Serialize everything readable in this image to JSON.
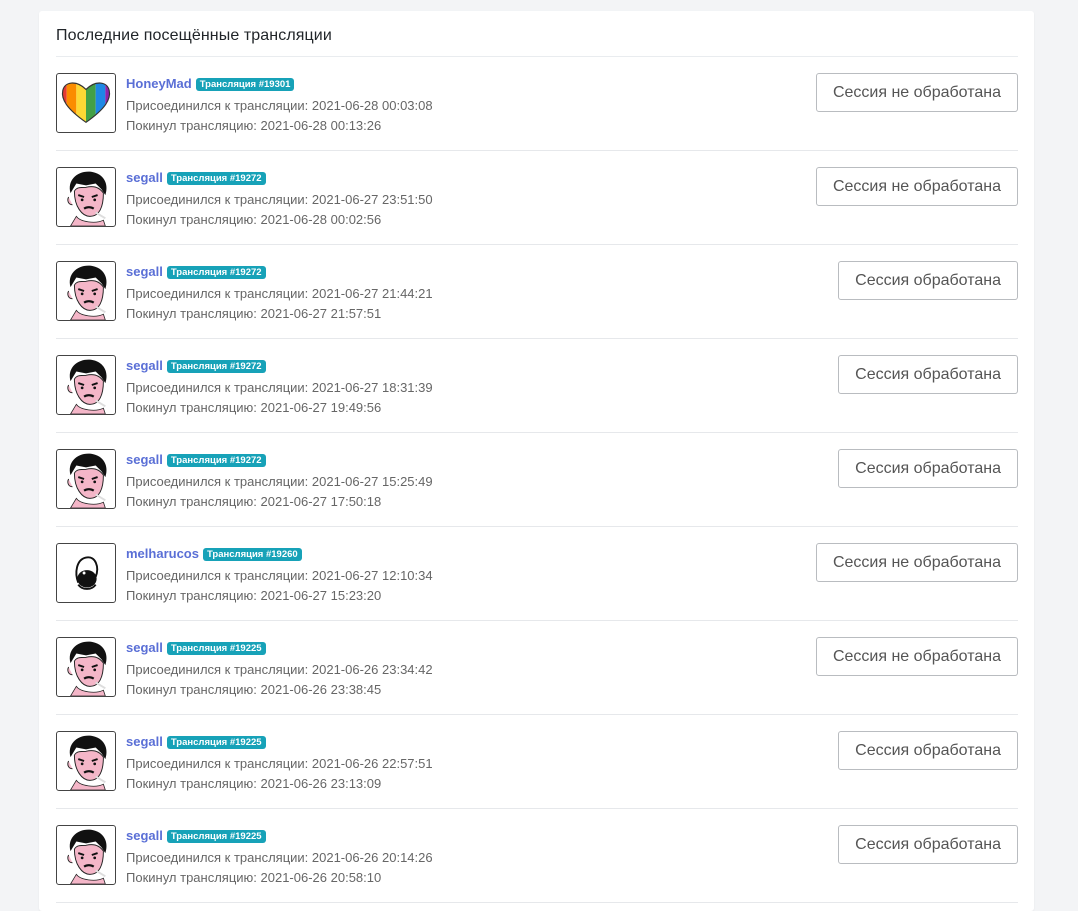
{
  "page": {
    "title": "Последние посещённые трансляции"
  },
  "sessions": [
    {
      "user": "HoneyMad",
      "avatar": "rainbow-heart",
      "badge": "Трансляция #19301",
      "joined": "Присоединился к трансляции: 2021-06-28 00:03:08",
      "left": "Покинул трансляцию: 2021-06-28 00:13:26",
      "status": "Сессия не обработана"
    },
    {
      "user": "segall",
      "avatar": "man-portrait",
      "badge": "Трансляция #19272",
      "joined": "Присоединился к трансляции: 2021-06-27 23:51:50",
      "left": "Покинул трансляцию: 2021-06-28 00:02:56",
      "status": "Сессия не обработана"
    },
    {
      "user": "segall",
      "avatar": "man-portrait",
      "badge": "Трансляция #19272",
      "joined": "Присоединился к трансляции: 2021-06-27 21:44:21",
      "left": "Покинул трансляцию: 2021-06-27 21:57:51",
      "status": "Сессия обработана"
    },
    {
      "user": "segall",
      "avatar": "man-portrait",
      "badge": "Трансляция #19272",
      "joined": "Присоединился к трансляции: 2021-06-27 18:31:39",
      "left": "Покинул трансляцию: 2021-06-27 19:49:56",
      "status": "Сессия обработана"
    },
    {
      "user": "segall",
      "avatar": "man-portrait",
      "badge": "Трансляция #19272",
      "joined": "Присоединился к трансляции: 2021-06-27 15:25:49",
      "left": "Покинул трансляцию: 2021-06-27 17:50:18",
      "status": "Сессия обработана"
    },
    {
      "user": "melharucos",
      "avatar": "line-drawing",
      "badge": "Трансляция #19260",
      "joined": "Присоединился к трансляции: 2021-06-27 12:10:34",
      "left": "Покинул трансляцию: 2021-06-27 15:23:20",
      "status": "Сессия не обработана"
    },
    {
      "user": "segall",
      "avatar": "man-portrait",
      "badge": "Трансляция #19225",
      "joined": "Присоединился к трансляции: 2021-06-26 23:34:42",
      "left": "Покинул трансляцию: 2021-06-26 23:38:45",
      "status": "Сессия не обработана"
    },
    {
      "user": "segall",
      "avatar": "man-portrait",
      "badge": "Трансляция #19225",
      "joined": "Присоединился к трансляции: 2021-06-26 22:57:51",
      "left": "Покинул трансляцию: 2021-06-26 23:13:09",
      "status": "Сессия обработана"
    },
    {
      "user": "segall",
      "avatar": "man-portrait",
      "badge": "Трансляция #19225",
      "joined": "Присоединился к трансляции: 2021-06-26 20:14:26",
      "left": "Покинул трансляцию: 2021-06-26 20:58:10",
      "status": "Сессия обработана"
    }
  ],
  "colors": {
    "username": "#5a6fd6",
    "badge": "#17a2b8",
    "button_border": "#b9bcc0"
  }
}
